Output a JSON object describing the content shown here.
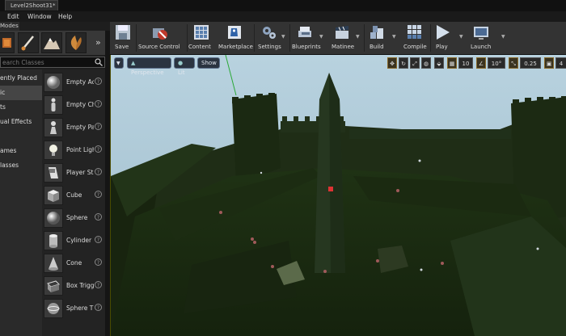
{
  "window": {
    "doc_tab": "Level2Shoot31*"
  },
  "menu": {
    "items": [
      "Edit",
      "Window",
      "Help"
    ]
  },
  "modes": {
    "tab_label": "Modes",
    "icons": [
      "place-mode-icon",
      "paint-mode-icon",
      "landscape-mode-icon",
      "foliage-mode-icon"
    ]
  },
  "search": {
    "placeholder": "earch Classes"
  },
  "categories": [
    "ently Placed",
    "ic",
    "ts",
    "ual Effects",
    "",
    "ames",
    "lasses"
  ],
  "place_items": [
    {
      "label": "Empty Ac",
      "icon": "sphere-icon"
    },
    {
      "label": "Empty Ch",
      "icon": "character-icon"
    },
    {
      "label": "Empty Pa",
      "icon": "pawn-icon"
    },
    {
      "label": "Point Ligh",
      "icon": "light-bulb-icon"
    },
    {
      "label": "Player St",
      "icon": "player-start-icon"
    },
    {
      "label": "Cube",
      "icon": "cube-icon"
    },
    {
      "label": "Sphere",
      "icon": "sphere-icon"
    },
    {
      "label": "Cylinder",
      "icon": "cylinder-icon"
    },
    {
      "label": "Cone",
      "icon": "cone-icon"
    },
    {
      "label": "Box Trigg",
      "icon": "box-trigger-icon"
    },
    {
      "label": "Sphere T",
      "icon": "sphere-trigger-icon"
    }
  ],
  "help_glyph": "?",
  "toolbar": {
    "save": "Save",
    "source_control": "Source Control",
    "content": "Content",
    "marketplace": "Marketplace",
    "settings": "Settings",
    "blueprints": "Blueprints",
    "matinee": "Matinee",
    "build": "Build",
    "compile": "Compile",
    "play": "Play",
    "launch": "Launch"
  },
  "viewport": {
    "perspective": "Perspective",
    "lit": "Lit",
    "show": "Show",
    "grid_snap": "10",
    "rotation_snap": "10°",
    "scale_snap": "0.25",
    "camera_speed": "4"
  },
  "colors": {
    "accent_yellow": "#c9a227",
    "sky": "#a9c6d6",
    "scene_dark": "#1b2a12"
  }
}
